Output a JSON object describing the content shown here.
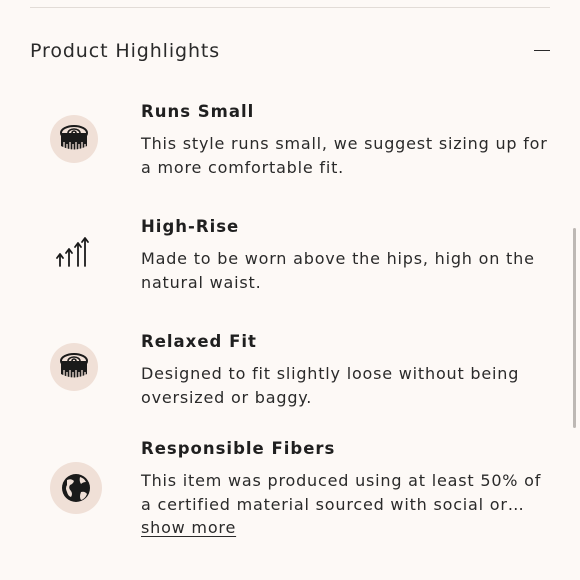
{
  "section": {
    "title": "Product Highlights",
    "collapse_icon": "minus-icon"
  },
  "highlights": [
    {
      "icon": "measuring-tape-icon",
      "title": "Runs Small",
      "description": "This style runs small, we suggest sizing up for a more comfortable fit."
    },
    {
      "icon": "high-rise-arrows-icon",
      "title": "High-Rise",
      "description": "Made to be worn above the hips, high on the natural waist."
    },
    {
      "icon": "measuring-tape-icon",
      "title": "Relaxed Fit",
      "description": "Designed to fit slightly loose without being oversized or baggy."
    },
    {
      "icon": "globe-icon",
      "title": "Responsible Fibers",
      "description": "This item was produced using at least 50% of a certified material sourced with social or…"
    }
  ],
  "show_more_label": "show more",
  "colors": {
    "background": "#fdf9f6",
    "icon_circle": "#f0e0d7",
    "text": "#1f1f1f",
    "divider": "#e2dcd7"
  }
}
